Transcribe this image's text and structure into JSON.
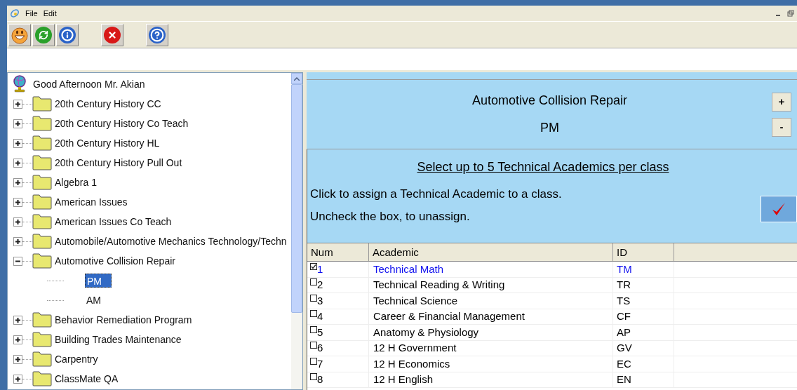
{
  "menu": [
    "File",
    "Edit"
  ],
  "tree": {
    "root": "Good Afternoon Mr. Akian",
    "items": [
      {
        "label": "20th Century History CC",
        "expanded": false
      },
      {
        "label": "20th Century History Co Teach",
        "expanded": false
      },
      {
        "label": "20th Century History HL",
        "expanded": false
      },
      {
        "label": "20th Century History Pull Out",
        "expanded": false
      },
      {
        "label": "Algebra 1",
        "expanded": false
      },
      {
        "label": "American Issues",
        "expanded": false
      },
      {
        "label": "American Issues Co Teach",
        "expanded": false
      },
      {
        "label": "Automobile/Automotive Mechanics Technology/Techn",
        "expanded": false
      },
      {
        "label": "Automotive Collision Repair",
        "expanded": true,
        "children": [
          {
            "label": "PM",
            "selected": true
          },
          {
            "label": "AM",
            "selected": false
          }
        ]
      },
      {
        "label": "Behavior Remediation Program",
        "expanded": false
      },
      {
        "label": "Building Trades Maintenance",
        "expanded": false
      },
      {
        "label": "Carpentry",
        "expanded": false
      },
      {
        "label": "ClassMate QA",
        "expanded": false
      }
    ]
  },
  "class_header": {
    "title": "Automotive Collision Repair",
    "subtitle": "PM",
    "buttons": [
      "+",
      "-"
    ]
  },
  "instructions": {
    "heading": "Select up to 5 Technical Academics per class",
    "lines": [
      "Click to assign a Technical Academic to a class.",
      "Uncheck the box, to unassign."
    ]
  },
  "table": {
    "columns": [
      "Num",
      "Academic",
      "ID"
    ],
    "rows": [
      {
        "num": "1",
        "academic": "Technical Math",
        "id": "TM",
        "checked": true
      },
      {
        "num": "2",
        "academic": "Technical Reading & Writing",
        "id": "TR",
        "checked": false
      },
      {
        "num": "3",
        "academic": "Technical Science",
        "id": "TS",
        "checked": false
      },
      {
        "num": "4",
        "academic": "Career & Financial Management",
        "id": "CF",
        "checked": false
      },
      {
        "num": "5",
        "academic": "Anatomy & Physiology",
        "id": "AP",
        "checked": false
      },
      {
        "num": "6",
        "academic": "12 H Government",
        "id": "GV",
        "checked": false
      },
      {
        "num": "7",
        "academic": "12 H Economics",
        "id": "EC",
        "checked": false
      },
      {
        "num": "8",
        "academic": "12 H English",
        "id": "EN",
        "checked": false
      }
    ]
  }
}
